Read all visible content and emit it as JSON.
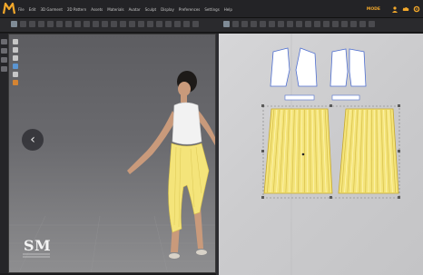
{
  "app": {
    "logo": "garment-cad-logo",
    "mode_label": "MODE"
  },
  "menu": [
    "File",
    "Edit",
    "3D Garment",
    "2D Pattern",
    "Assets",
    "Materials",
    "Avatar",
    "Sculpt",
    "Display",
    "Preferences",
    "Settings",
    "Help"
  ],
  "viewport3d": {
    "nav_icon": "chevron-left-icon",
    "watermark_text": "SM"
  },
  "pattern2d": {
    "pieces": [
      "bodice-front-left",
      "bodice-front-right",
      "waistband-left",
      "waistband-right",
      "skirt-pleat-left",
      "skirt-pleat-right"
    ]
  },
  "colors": {
    "accent": "#f2a82b",
    "garment_yellow": "#f4e47a",
    "pattern_outline": "#4f6fd1",
    "selection": "#7a7a7a"
  }
}
